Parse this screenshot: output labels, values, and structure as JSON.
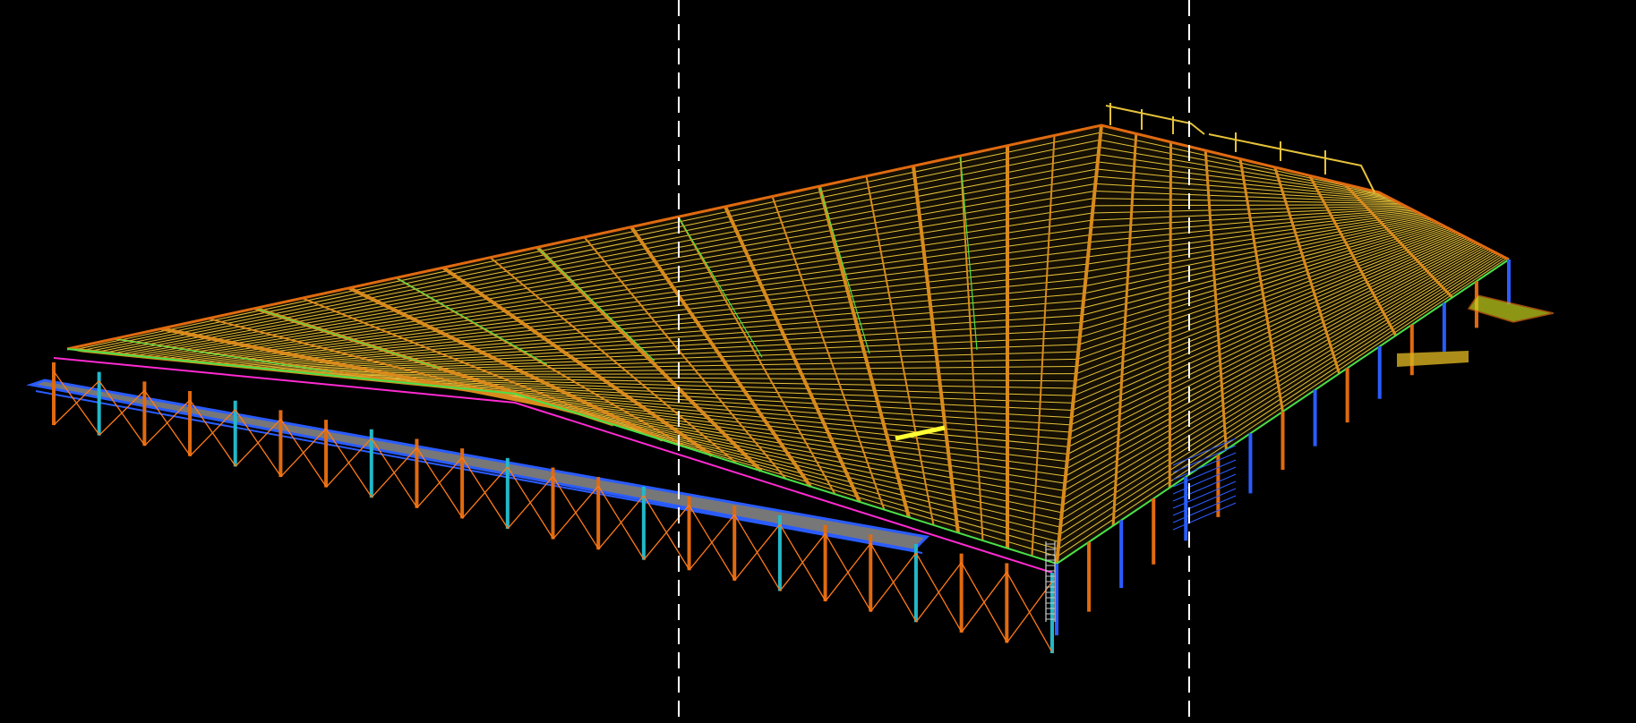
{
  "view": {
    "background": "#000000",
    "guide_color": "#ffffff",
    "guides": [
      "section-guide-left",
      "section-guide-right"
    ]
  },
  "model": {
    "kind": "steel-structure-3d-wireframe",
    "colors": {
      "roof_purlin": "#e6c23a",
      "roof_rafter": "#d98a1c",
      "roof_tie": "#c9d41f",
      "column_orange": "#e06a10",
      "column_cyan": "#22b8c8",
      "bracing": "#ff7a1a",
      "wall_girt_blue": "#2a5cff",
      "eave_magenta": "#ff2ad2",
      "edge_green": "#49e04a",
      "walkway_gray": "#8b8b8b",
      "highlight_yellow": "#ffff33"
    }
  }
}
